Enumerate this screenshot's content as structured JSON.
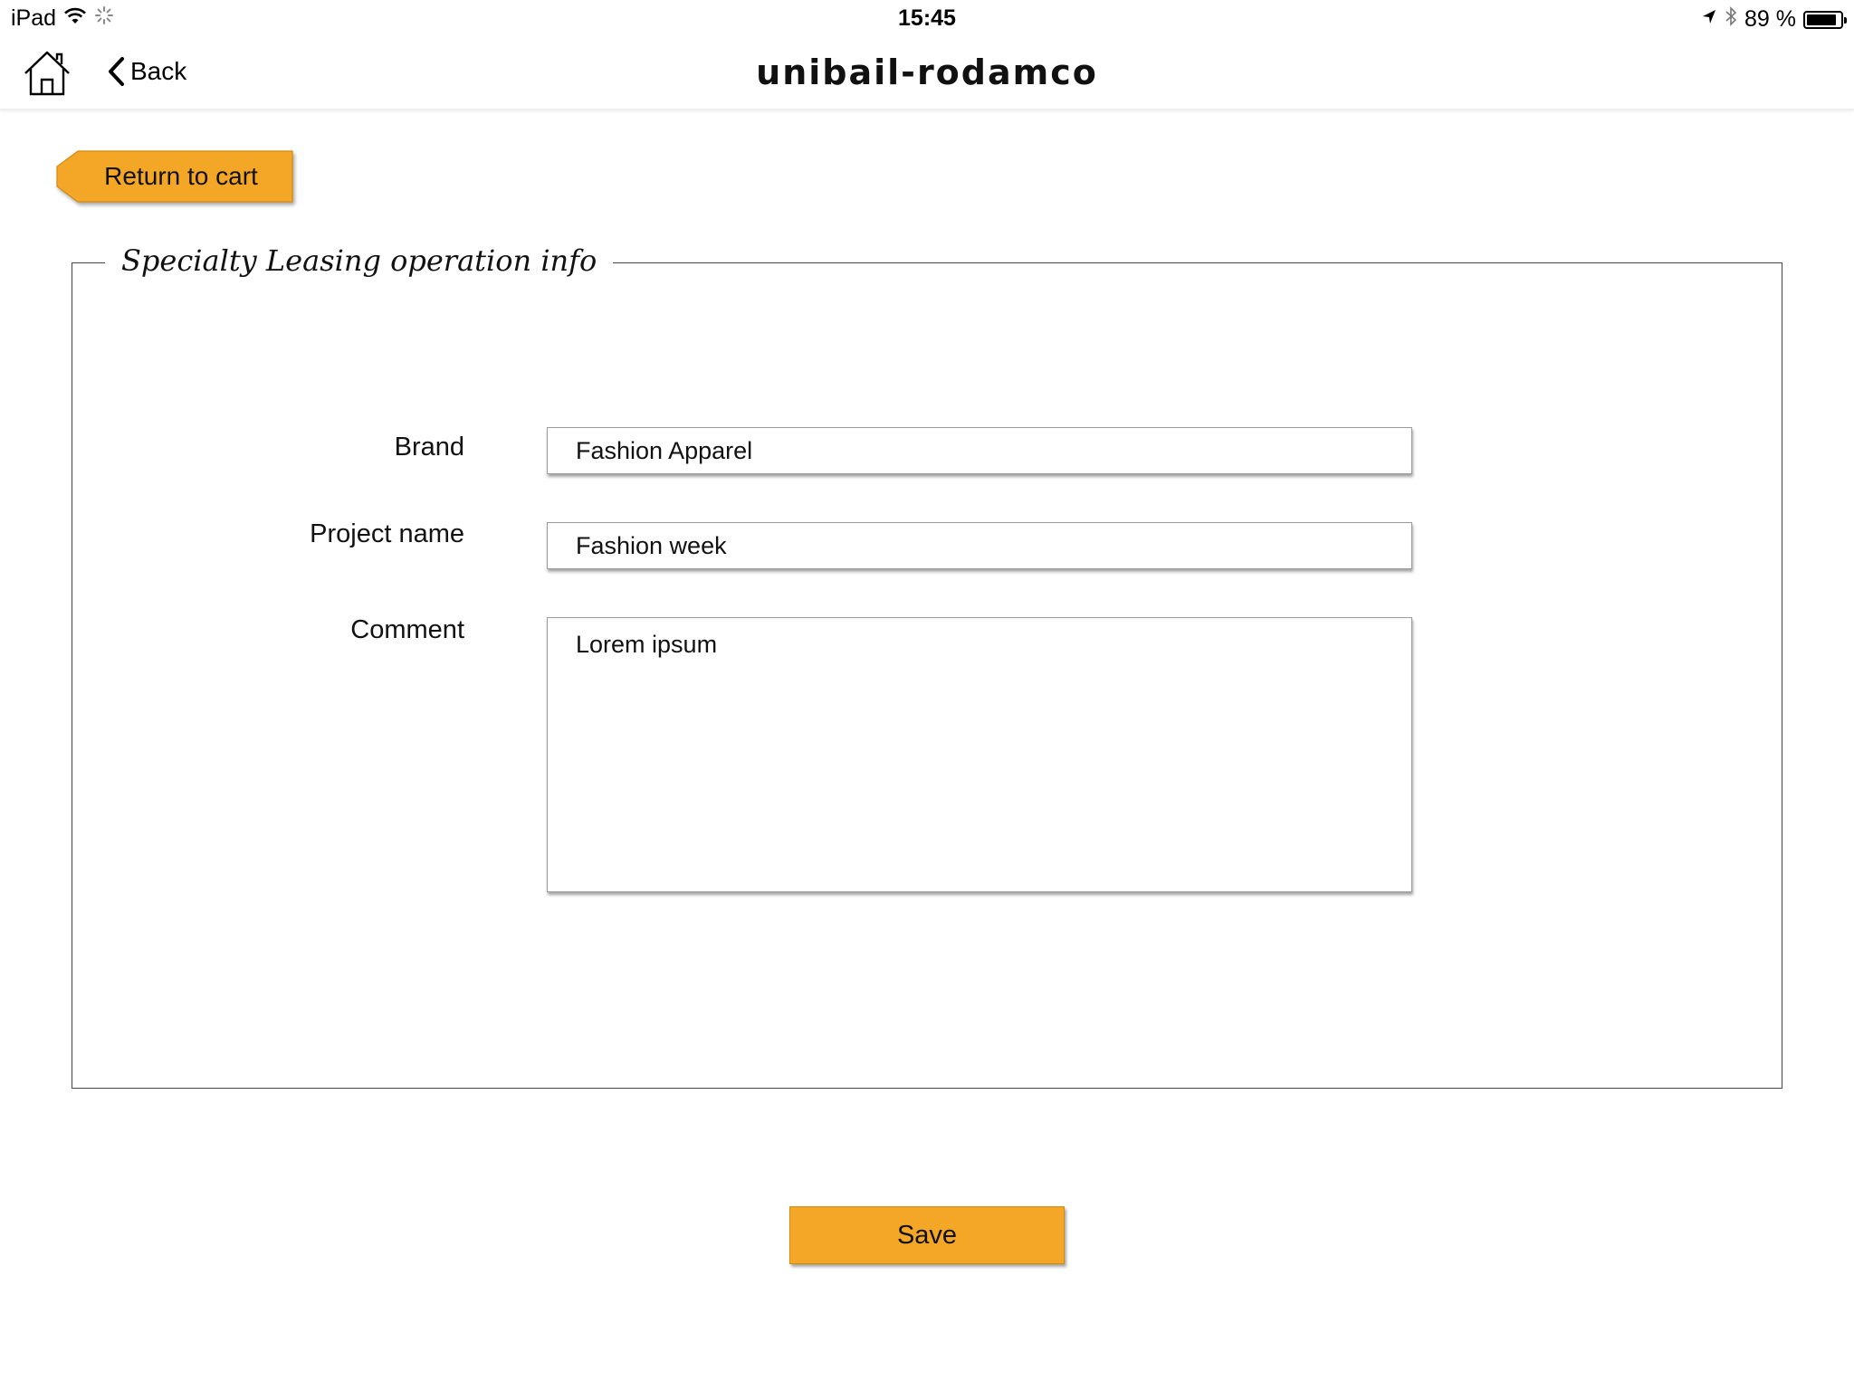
{
  "status_bar": {
    "device": "iPad",
    "time": "15:45",
    "battery_text": "89 %",
    "battery_level": 0.89
  },
  "navbar": {
    "back_label": "Back",
    "title": "unibail-rodamco"
  },
  "return_button": {
    "label": "Return to cart"
  },
  "section": {
    "legend": "Specialty Leasing operation info"
  },
  "form": {
    "brand": {
      "label": "Brand",
      "value": "Fashion Apparel"
    },
    "project_name": {
      "label": "Project name",
      "value": "Fashion week"
    },
    "comment": {
      "label": "Comment",
      "value": "Lorem ipsum"
    }
  },
  "save_button": {
    "label": "Save"
  },
  "colors": {
    "accent": "#f4a726",
    "border": "#444444"
  }
}
